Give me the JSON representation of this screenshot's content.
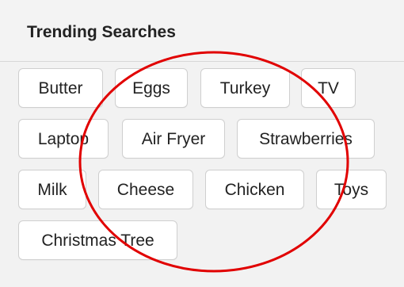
{
  "panel": {
    "title": "Trending Searches"
  },
  "tags": [
    "Butter",
    "Eggs",
    "Turkey",
    "TV",
    "Laptop",
    "Air Fryer",
    "Strawberries",
    "Milk",
    "Cheese",
    "Chicken",
    "Toys",
    "Christmas Tree"
  ],
  "colors": {
    "panel_background": "#f2f2f2",
    "tag_background": "#ffffff",
    "tag_border": "#cfcfcf",
    "text": "#222222",
    "annotation": "#e10000"
  }
}
